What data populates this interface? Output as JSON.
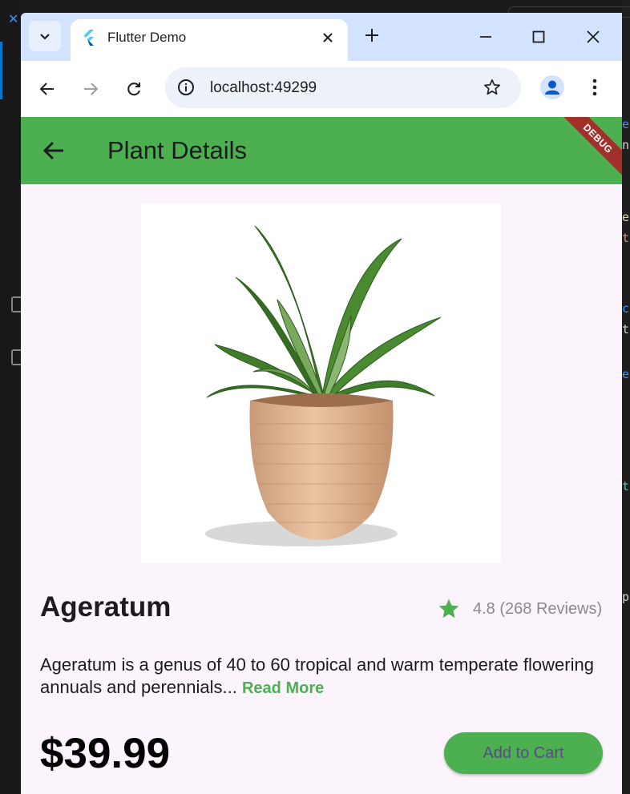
{
  "browser": {
    "tab_title": "Flutter Demo",
    "url": "localhost:49299"
  },
  "app": {
    "title": "Plant Details",
    "debug_label": "DEBUG",
    "plant": {
      "name": "Ageratum",
      "rating": "4.8",
      "reviews": "(268 Reviews)",
      "description": "Ageratum is a genus of 40 to 60 tropical and warm temperate flowering annuals and perennials...",
      "read_more": "Read More",
      "price": "$39.99"
    },
    "add_to_cart_label": "Add to Cart"
  },
  "colors": {
    "accent": "#4caf50",
    "browser_frame": "#d3e3fd",
    "debug_banner": "#a0302a",
    "button_text": "#5b4a86"
  },
  "icons": {
    "tab_search": "chevron-down-icon",
    "favicon": "flutter-logo-icon",
    "tab_close": "close-icon",
    "new_tab": "plus-icon",
    "back": "arrow-left-icon",
    "forward": "arrow-right-icon",
    "reload": "reload-icon",
    "site_info": "info-icon",
    "bookmark": "star-outline-icon",
    "profile": "person-icon",
    "menu": "kebab-menu-icon",
    "rating": "star-filled-icon"
  }
}
